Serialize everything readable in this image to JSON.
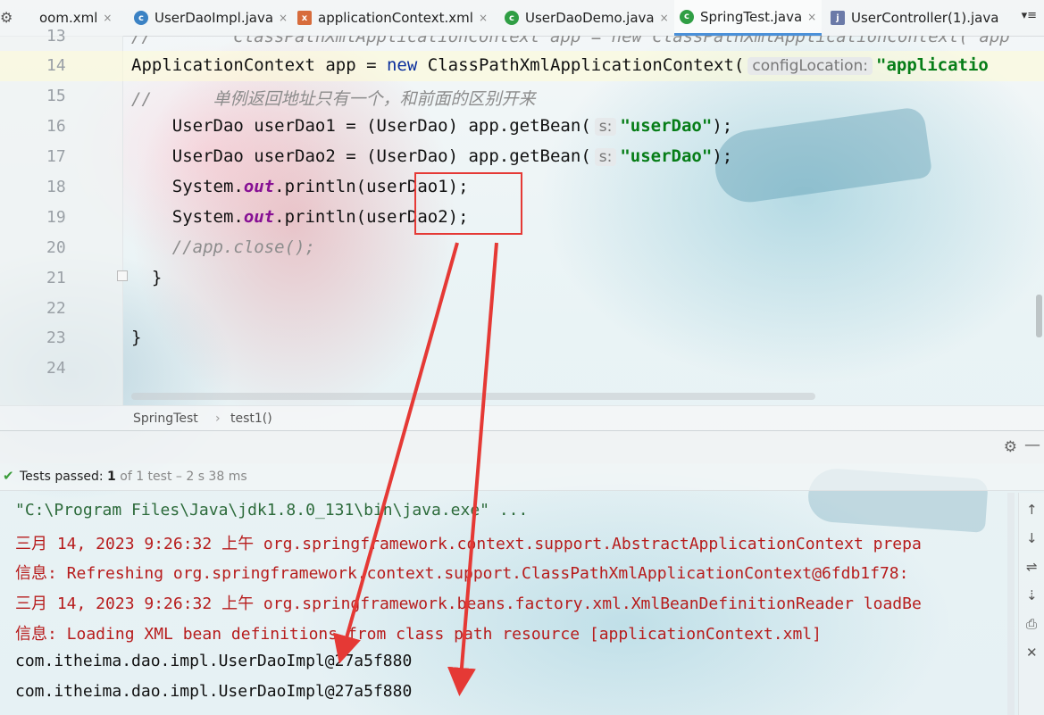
{
  "tabs": [
    {
      "label": "pom.xml",
      "visible_label": "oom.xml",
      "icon": "maven-xml-icon"
    },
    {
      "label": "UserDaoImpl.java",
      "icon": "java-class-icon"
    },
    {
      "label": "applicationContext.xml",
      "icon": "spring-xml-icon"
    },
    {
      "label": "UserDaoDemo.java",
      "icon": "java-class-run-icon"
    },
    {
      "label": "SpringTest.java",
      "icon": "java-class-run-icon",
      "active": true
    },
    {
      "label": "UserController(1).java",
      "icon": "java-file-icon"
    }
  ],
  "tab_close_glyph": "×",
  "tab_overflow_glyph": "▾≡",
  "editor": {
    "line_numbers": [
      "13",
      "14",
      "15",
      "16",
      "17",
      "18",
      "19",
      "20",
      "21",
      "22",
      "23",
      "24"
    ],
    "line13": "//        ClassPathXmlApplicationContext app = new ClassPathXmlApplicationContext( app",
    "line14_a": "ApplicationContext app = ",
    "line14_kw": "new",
    "line14_b": " ClassPathXmlApplicationContext(",
    "line14_hint": "configLocation:",
    "line14_str": "\"applicatio",
    "line15": "//      单例返回地址只有一个，和前面的区别开来",
    "line16_a": "    UserDao userDao1 = (UserDao) app.getBean(",
    "line16_hint": "s:",
    "line16_str": "\"userDao\"",
    "line16_b": ");",
    "line17_a": "    UserDao userDao2 = (UserDao) app.getBean(",
    "line17_hint": "s:",
    "line17_str": "\"userDao\"",
    "line17_b": ");",
    "line18_a": "    System.",
    "line18_field": "out",
    "line18_b": ".println(userDao1);",
    "line19_a": "    System.",
    "line19_field": "out",
    "line19_b": ".println(userDao2);",
    "line20": "    //app.close();",
    "line21": "  }",
    "line23": "}"
  },
  "breadcrumb": {
    "class": "SpringTest",
    "separator": "›",
    "method": "test1()"
  },
  "run": {
    "status_prefix": "Tests passed: ",
    "status_count": "1",
    "status_rest": " of 1 test – 2 s 38 ms",
    "console": [
      {
        "type": "cmd",
        "text": "\"C:\\Program Files\\Java\\jdk1.8.0_131\\bin\\java.exe\" ..."
      },
      {
        "type": "err",
        "text": "三月 14, 2023 9:26:32 上午 org.springframework.context.support.AbstractApplicationContext prepa"
      },
      {
        "type": "err",
        "text": "信息: Refreshing org.springframework.context.support.ClassPathXmlApplicationContext@6fdb1f78:"
      },
      {
        "type": "err",
        "text": "三月 14, 2023 9:26:32 上午 org.springframework.beans.factory.xml.XmlBeanDefinitionReader loadBe"
      },
      {
        "type": "err",
        "text": "信息: Loading XML bean definitions from class path resource [applicationContext.xml]"
      },
      {
        "type": "out",
        "text": "com.itheima.dao.impl.UserDaoImpl@27a5f880"
      },
      {
        "type": "out",
        "text": "com.itheima.dao.impl.UserDaoImpl@27a5f880"
      }
    ]
  },
  "colors": {
    "annotation": "#e53935",
    "keyword": "#0a2e9c",
    "string": "#067d17",
    "field": "#871094",
    "stderr": "#b71c1c"
  }
}
